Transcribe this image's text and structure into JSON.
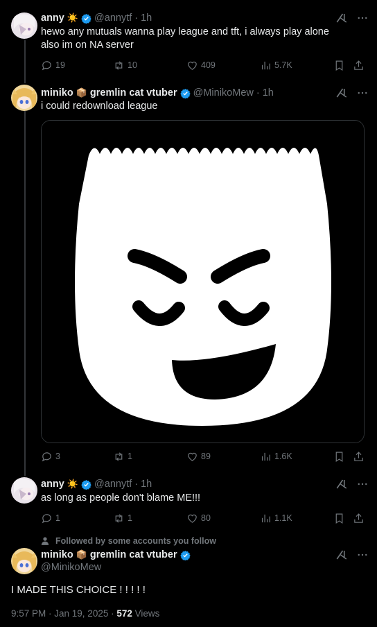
{
  "tweets": [
    {
      "name": "anny",
      "emoji": "☀️",
      "handle": "@annytf",
      "time": "· 1h",
      "text": "hewo any mutuals wanna play league and tft, i always play alone also im on NA server",
      "replies": "19",
      "retweets": "10",
      "likes": "409",
      "views": "5.7K"
    },
    {
      "name": "miniko",
      "emoji": "📦",
      "name_suffix": "gremlin cat vtuber",
      "handle": "@MinikoMew",
      "time": "· 1h",
      "text": "i could redownload league",
      "replies": "3",
      "retweets": "1",
      "likes": "89",
      "views": "1.6K"
    },
    {
      "name": "anny",
      "emoji": "☀️",
      "handle": "@annytf",
      "time": "· 1h",
      "text": "as long as people don't blame ME!!!",
      "replies": "1",
      "retweets": "1",
      "likes": "80",
      "views": "1.1K"
    }
  ],
  "main_tweet": {
    "followed_label": "Followed by some accounts you follow",
    "name": "miniko",
    "emoji": "📦",
    "name_suffix": "gremlin cat vtuber",
    "handle": "@MinikoMew",
    "text": "I MADE THIS CHOICE ! ! ! ! !",
    "timestamp": "9:57 PM · Jan 19, 2025 · ",
    "views_count": "572",
    "views_label": " Views"
  },
  "colors": {
    "background": "#000000",
    "text": "#e7e9ea",
    "muted": "#71767b",
    "verified": "#1d9bf0"
  },
  "icons": [
    "reply-icon",
    "retweet-icon",
    "like-icon",
    "views-icon",
    "bookmark-icon",
    "share-icon",
    "grok-icon",
    "more-icon",
    "verified-icon",
    "person-icon"
  ]
}
